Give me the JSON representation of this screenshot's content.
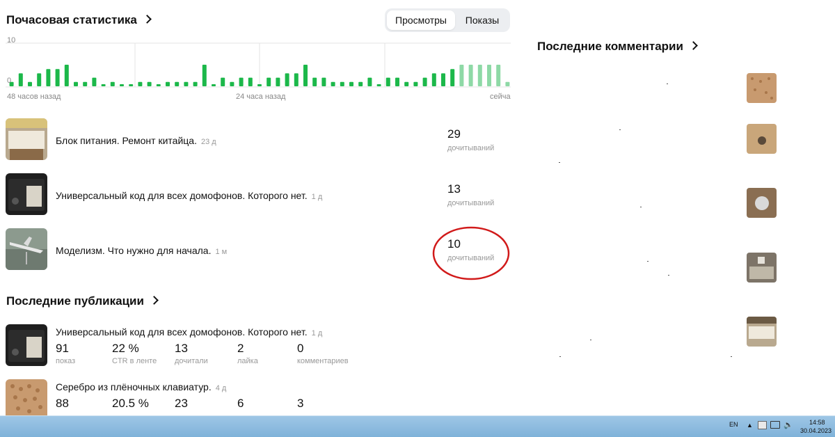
{
  "hourly": {
    "title": "Почасовая статистика",
    "toggle": {
      "active": "Просмотры",
      "inactive": "Показы"
    },
    "chart_data": {
      "type": "bar",
      "ylim": [
        0,
        10
      ],
      "y_tick_labels": [
        "10",
        "0"
      ],
      "x_tick_labels": [
        "48 часов назад",
        "24 часа назад",
        "сейча"
      ],
      "values": [
        1,
        3,
        1,
        3,
        4,
        4,
        5,
        1,
        1,
        2,
        0,
        1,
        0,
        0,
        1,
        1,
        0,
        1,
        1,
        1,
        1,
        5,
        0,
        2,
        1,
        2,
        2,
        0,
        2,
        2,
        3,
        3,
        5,
        2,
        2,
        1,
        1,
        1,
        1,
        2,
        0,
        2,
        2,
        1,
        1,
        2,
        3,
        3,
        4
      ],
      "light_values": [
        5,
        5,
        5,
        5,
        5,
        1
      ]
    }
  },
  "top_articles": [
    {
      "title": "Блок питания. Ремонт китайца.",
      "age": "23 д",
      "reads": "29",
      "reads_label": "дочитываний"
    },
    {
      "title": "Универсальный код для всех домофонов. Которого нет.",
      "age": "1 д",
      "reads": "13",
      "reads_label": "дочитываний"
    },
    {
      "title": "Моделизм. Что нужно для начала.",
      "age": "1 м",
      "reads": "10",
      "reads_label": "дочитываний"
    }
  ],
  "recent": {
    "title": "Последние публикации",
    "items": [
      {
        "title": "Универсальный код для всех домофонов. Которого нет.",
        "age": "1 д",
        "metrics": [
          {
            "num": "91",
            "label": "показ"
          },
          {
            "num": "22 %",
            "label": "CTR в ленте"
          },
          {
            "num": "13",
            "label": "дочитали"
          },
          {
            "num": "2",
            "label": "лайка"
          },
          {
            "num": "0",
            "label": "комментариев"
          }
        ]
      },
      {
        "title": "Серебро из плёночных клавиатур.",
        "age": "4 д",
        "metrics": [
          {
            "num": "88",
            "label": ""
          },
          {
            "num": "20.5 %",
            "label": ""
          },
          {
            "num": "23",
            "label": ""
          },
          {
            "num": "6",
            "label": ""
          },
          {
            "num": "3",
            "label": ""
          }
        ]
      }
    ]
  },
  "comments": {
    "title": "Последние комментарии"
  },
  "taskbar": {
    "lang": "EN",
    "time": "14:58",
    "date": "30.04.2023"
  },
  "colors": {
    "bar": "#1cb84a",
    "bar_light": "#8ed9a6",
    "highlight_circle": "#d11a1a"
  }
}
